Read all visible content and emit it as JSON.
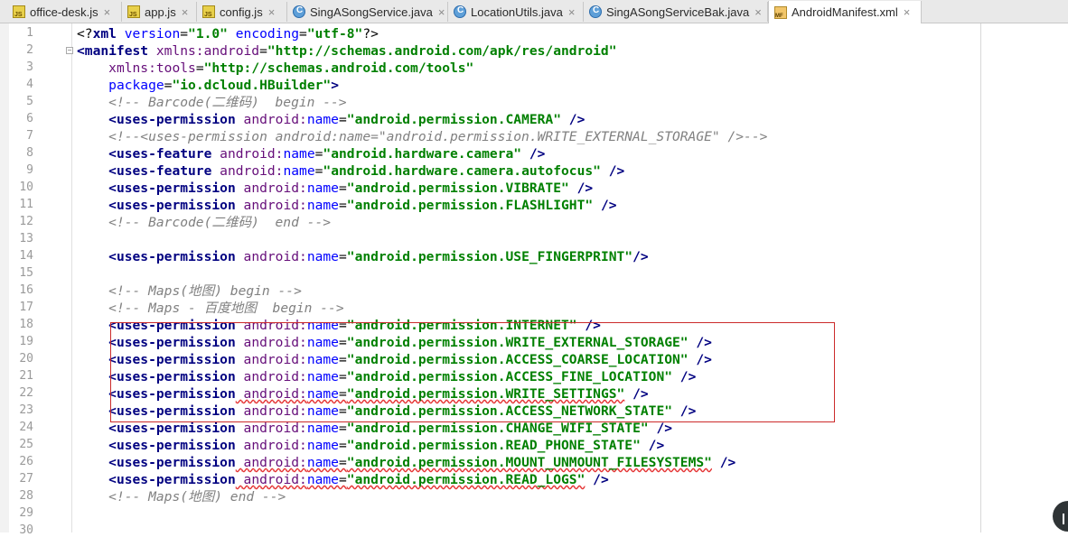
{
  "tabs": [
    {
      "label": "office-desk.js",
      "icon": "js-file-icon",
      "active": false
    },
    {
      "label": "app.js",
      "icon": "js-file-icon",
      "active": false
    },
    {
      "label": "config.js",
      "icon": "js-file-icon",
      "active": false
    },
    {
      "label": "SingASongService.java",
      "icon": "java-class-icon",
      "active": false
    },
    {
      "label": "LocationUtils.java",
      "icon": "java-class-icon",
      "active": false
    },
    {
      "label": "SingASongServiceBak.java",
      "icon": "java-class-icon",
      "active": false
    },
    {
      "label": "AndroidManifest.xml",
      "icon": "manifest-file-icon",
      "active": true
    }
  ],
  "close_glyph": "×",
  "line_numbers": [
    "1",
    "2",
    "3",
    "4",
    "5",
    "6",
    "7",
    "8",
    "9",
    "10",
    "11",
    "12",
    "13",
    "14",
    "15",
    "16",
    "17",
    "18",
    "19",
    "20",
    "21",
    "22",
    "23",
    "24",
    "25",
    "26",
    "27",
    "28",
    "29",
    "30"
  ],
  "code_lines": [
    [
      [
        "def",
        "<?"
      ],
      [
        "tag",
        "xml"
      ],
      [
        "attr",
        " version"
      ],
      [
        "def",
        "="
      ],
      [
        "val",
        "\"1.0\""
      ],
      [
        "attr",
        " encoding"
      ],
      [
        "def",
        "="
      ],
      [
        "val",
        "\"utf-8\""
      ],
      [
        "def",
        "?>"
      ]
    ],
    [
      [
        "tag",
        "<manifest"
      ],
      [
        "ns",
        " xmlns:android"
      ],
      [
        "def",
        "="
      ],
      [
        "val",
        "\"http://schemas.android.com/apk/res/android\""
      ]
    ],
    [
      [
        "ind",
        "    "
      ],
      [
        "ns",
        "xmlns:tools"
      ],
      [
        "def",
        "="
      ],
      [
        "val",
        "\"http://schemas.android.com/tools\""
      ]
    ],
    [
      [
        "ind",
        "    "
      ],
      [
        "attr",
        "package"
      ],
      [
        "def",
        "="
      ],
      [
        "val",
        "\"io.dcloud.HBuilder\""
      ],
      [
        "tag",
        ">"
      ]
    ],
    [
      [
        "ind",
        "    "
      ],
      [
        "comment",
        "<!-- Barcode(二维码)  begin -->"
      ]
    ],
    [
      [
        "ind",
        "    "
      ],
      [
        "tag",
        "<uses-permission"
      ],
      [
        "ns",
        " android:"
      ],
      [
        "attr",
        "name"
      ],
      [
        "def",
        "="
      ],
      [
        "val",
        "\"android.permission.CAMERA\""
      ],
      [
        "tag",
        " />"
      ]
    ],
    [
      [
        "ind",
        "    "
      ],
      [
        "comment",
        "<!--<uses-permission android:name=\"android.permission.WRITE_EXTERNAL_STORAGE\" />-->"
      ]
    ],
    [
      [
        "ind",
        "    "
      ],
      [
        "tag",
        "<uses-feature"
      ],
      [
        "ns",
        " android:"
      ],
      [
        "attr",
        "name"
      ],
      [
        "def",
        "="
      ],
      [
        "val",
        "\"android.hardware.camera\""
      ],
      [
        "tag",
        " />"
      ]
    ],
    [
      [
        "ind",
        "    "
      ],
      [
        "tag",
        "<uses-feature"
      ],
      [
        "ns",
        " android:"
      ],
      [
        "attr",
        "name"
      ],
      [
        "def",
        "="
      ],
      [
        "val",
        "\"android.hardware.camera.autofocus\""
      ],
      [
        "tag",
        " />"
      ]
    ],
    [
      [
        "ind",
        "    "
      ],
      [
        "tag",
        "<uses-permission"
      ],
      [
        "ns",
        " android:"
      ],
      [
        "attr",
        "name"
      ],
      [
        "def",
        "="
      ],
      [
        "val",
        "\"android.permission.VIBRATE\""
      ],
      [
        "tag",
        " />"
      ]
    ],
    [
      [
        "ind",
        "    "
      ],
      [
        "tag",
        "<uses-permission"
      ],
      [
        "ns",
        " android:"
      ],
      [
        "attr",
        "name"
      ],
      [
        "def",
        "="
      ],
      [
        "val",
        "\"android.permission.FLASHLIGHT\""
      ],
      [
        "tag",
        " />"
      ]
    ],
    [
      [
        "ind",
        "    "
      ],
      [
        "comment",
        "<!-- Barcode(二维码)  end -->"
      ]
    ],
    [],
    [
      [
        "ind",
        "    "
      ],
      [
        "tag",
        "<uses-permission"
      ],
      [
        "ns",
        " android:"
      ],
      [
        "attr",
        "name"
      ],
      [
        "def",
        "="
      ],
      [
        "val",
        "\"android.permission.USE_FINGERPRINT\""
      ],
      [
        "tag",
        "/>"
      ]
    ],
    [],
    [
      [
        "ind",
        "    "
      ],
      [
        "comment",
        "<!-- Maps(地图) begin -->"
      ]
    ],
    [
      [
        "ind",
        "    "
      ],
      [
        "comment",
        "<!-- Maps - 百度地图  begin -->"
      ]
    ],
    [
      [
        "ind",
        "    "
      ],
      [
        "tag",
        "<uses-permission"
      ],
      [
        "ns",
        " android:"
      ],
      [
        "attr",
        "name"
      ],
      [
        "def",
        "="
      ],
      [
        "val",
        "\"android.permission.INTERNET\""
      ],
      [
        "tag",
        " />"
      ]
    ],
    [
      [
        "ind",
        "    "
      ],
      [
        "tag",
        "<uses-permission"
      ],
      [
        "ns",
        " android:"
      ],
      [
        "attr",
        "name"
      ],
      [
        "def",
        "="
      ],
      [
        "val",
        "\"android.permission.WRITE_EXTERNAL_STORAGE\""
      ],
      [
        "tag",
        " />"
      ]
    ],
    [
      [
        "ind",
        "    "
      ],
      [
        "tag",
        "<uses-permission"
      ],
      [
        "ns",
        " android:"
      ],
      [
        "attr",
        "name"
      ],
      [
        "def",
        "="
      ],
      [
        "val",
        "\"android.permission.ACCESS_COARSE_LOCATION\""
      ],
      [
        "tag",
        " />"
      ]
    ],
    [
      [
        "ind",
        "    "
      ],
      [
        "tag",
        "<uses-permission"
      ],
      [
        "ns",
        " android:"
      ],
      [
        "attr",
        "name"
      ],
      [
        "def",
        "="
      ],
      [
        "val",
        "\"android.permission.ACCESS_FINE_LOCATION\""
      ],
      [
        "tag",
        " />"
      ]
    ],
    [
      [
        "ind",
        "    "
      ],
      [
        "tag",
        "<uses-permission"
      ],
      [
        "wns",
        " android:"
      ],
      [
        "wattr",
        "name"
      ],
      [
        "wdef",
        "="
      ],
      [
        "wval",
        "\"android.permission.WRITE_SETTINGS\""
      ],
      [
        "tag",
        " />"
      ]
    ],
    [
      [
        "ind",
        "    "
      ],
      [
        "tag",
        "<uses-permission"
      ],
      [
        "ns",
        " android:"
      ],
      [
        "attr",
        "name"
      ],
      [
        "def",
        "="
      ],
      [
        "val",
        "\"android.permission.ACCESS_NETWORK_STATE\""
      ],
      [
        "tag",
        " />"
      ]
    ],
    [
      [
        "ind",
        "    "
      ],
      [
        "tag",
        "<uses-permission"
      ],
      [
        "ns",
        " android:"
      ],
      [
        "attr",
        "name"
      ],
      [
        "def",
        "="
      ],
      [
        "val",
        "\"android.permission.CHANGE_WIFI_STATE\""
      ],
      [
        "tag",
        " />"
      ]
    ],
    [
      [
        "ind",
        "    "
      ],
      [
        "tag",
        "<uses-permission"
      ],
      [
        "ns",
        " android:"
      ],
      [
        "attr",
        "name"
      ],
      [
        "def",
        "="
      ],
      [
        "val",
        "\"android.permission.READ_PHONE_STATE\""
      ],
      [
        "tag",
        " />"
      ]
    ],
    [
      [
        "ind",
        "    "
      ],
      [
        "tag",
        "<uses-permission"
      ],
      [
        "wns",
        " android:"
      ],
      [
        "wattr",
        "name"
      ],
      [
        "wdef",
        "="
      ],
      [
        "wval",
        "\"android.permission.MOUNT_UNMOUNT_FILESYSTEMS\""
      ],
      [
        "tag",
        " />"
      ]
    ],
    [
      [
        "ind",
        "    "
      ],
      [
        "tag",
        "<uses-permission"
      ],
      [
        "wns",
        " android:"
      ],
      [
        "wattr",
        "name"
      ],
      [
        "wdef",
        "="
      ],
      [
        "wval",
        "\"android.permission.READ_LOGS\""
      ],
      [
        "tag",
        " />"
      ]
    ],
    [
      [
        "ind",
        "    "
      ],
      [
        "comment",
        "<!-- Maps(地图) end -->"
      ]
    ],
    [],
    []
  ],
  "colors": {
    "tag": "#000080",
    "attribute": "#0000ff",
    "namespace": "#660e7a",
    "value": "#008000",
    "comment": "#808080",
    "highlight_box": "#cc2b2b"
  }
}
